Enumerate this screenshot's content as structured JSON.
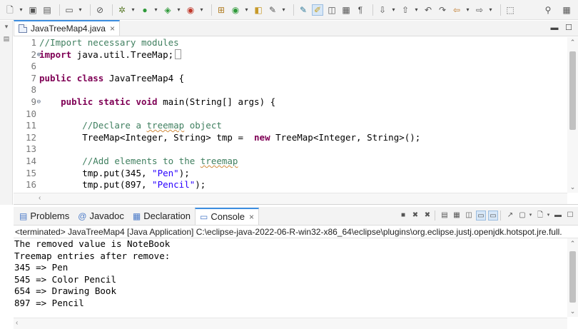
{
  "editor": {
    "tab_title": "JavaTreeMap4.java",
    "close_glyph": "×",
    "lines": [
      {
        "num": "1",
        "tokens": [
          {
            "t": "//Import necessary modules",
            "c": "cm"
          }
        ]
      },
      {
        "num": "2",
        "marker": "⊕",
        "tokens": [
          {
            "t": "import",
            "c": "kw"
          },
          {
            "t": " java.util.TreeMap;",
            "c": ""
          }
        ],
        "folded": true
      },
      {
        "num": "6",
        "tokens": []
      },
      {
        "num": "7",
        "tokens": [
          {
            "t": "public",
            "c": "kw"
          },
          {
            "t": " ",
            "c": ""
          },
          {
            "t": "class",
            "c": "kw"
          },
          {
            "t": " JavaTreeMap4 {",
            "c": ""
          }
        ]
      },
      {
        "num": "8",
        "tokens": []
      },
      {
        "num": "9",
        "marker": "⊖",
        "tokens": [
          {
            "t": "    ",
            "c": ""
          },
          {
            "t": "public",
            "c": "kw"
          },
          {
            "t": " ",
            "c": ""
          },
          {
            "t": "static",
            "c": "kw"
          },
          {
            "t": " ",
            "c": ""
          },
          {
            "t": "void",
            "c": "kw"
          },
          {
            "t": " main(String[] args) {",
            "c": ""
          }
        ]
      },
      {
        "num": "10",
        "tokens": []
      },
      {
        "num": "11",
        "tokens": [
          {
            "t": "        //Declare a ",
            "c": "cm"
          },
          {
            "t": "treemap",
            "c": "cm squig"
          },
          {
            "t": " object",
            "c": "cm"
          }
        ]
      },
      {
        "num": "12",
        "tokens": [
          {
            "t": "        TreeMap<Integer, String> tmp =  ",
            "c": ""
          },
          {
            "t": "new",
            "c": "kw"
          },
          {
            "t": " TreeMap<Integer, String>();",
            "c": ""
          }
        ]
      },
      {
        "num": "13",
        "tokens": []
      },
      {
        "num": "14",
        "tokens": [
          {
            "t": "        //Add elements to the ",
            "c": "cm"
          },
          {
            "t": "treemap",
            "c": "cm squig"
          }
        ]
      },
      {
        "num": "15",
        "tokens": [
          {
            "t": "        tmp.put(345, ",
            "c": ""
          },
          {
            "t": "\"Pen\"",
            "c": "st"
          },
          {
            "t": ");",
            "c": ""
          }
        ]
      },
      {
        "num": "16",
        "tokens": [
          {
            "t": "        tmp.put(897, ",
            "c": ""
          },
          {
            "t": "\"Pencil\"",
            "c": "st"
          },
          {
            "t": ");",
            "c": ""
          }
        ]
      }
    ]
  },
  "views": {
    "tabs": [
      {
        "label": "Problems",
        "icon": "problems-icon",
        "glyph": "▤"
      },
      {
        "label": "Javadoc",
        "icon": "javadoc-icon",
        "glyph": "@"
      },
      {
        "label": "Declaration",
        "icon": "declaration-icon",
        "glyph": "▦"
      },
      {
        "label": "Console",
        "icon": "console-icon",
        "glyph": "▭",
        "active": true
      }
    ],
    "console_close": "×",
    "status": "<terminated> JavaTreeMap4 [Java Application] C:\\eclipse-java-2022-06-R-win32-x86_64\\eclipse\\plugins\\org.eclipse.justj.openjdk.hotspot.jre.full.",
    "output": [
      "The removed value is NoteBook",
      "Treemap entries after remove:",
      "345 => Pen",
      "545 => Color Pencil",
      "654 => Drawing Book",
      "897 => Pencil"
    ]
  },
  "icons": {
    "toolbar": [
      "new-icon",
      "save-icon",
      "save-all-icon",
      "print-icon",
      "debug-icon",
      "run-icon",
      "coverage-icon",
      "external-tools-icon",
      "new-class-icon",
      "open-type-icon",
      "search-icon",
      "toggle-mark-icon",
      "back-icon",
      "forward-icon"
    ],
    "right": [
      "search-icon",
      "perspective-icon"
    ]
  }
}
